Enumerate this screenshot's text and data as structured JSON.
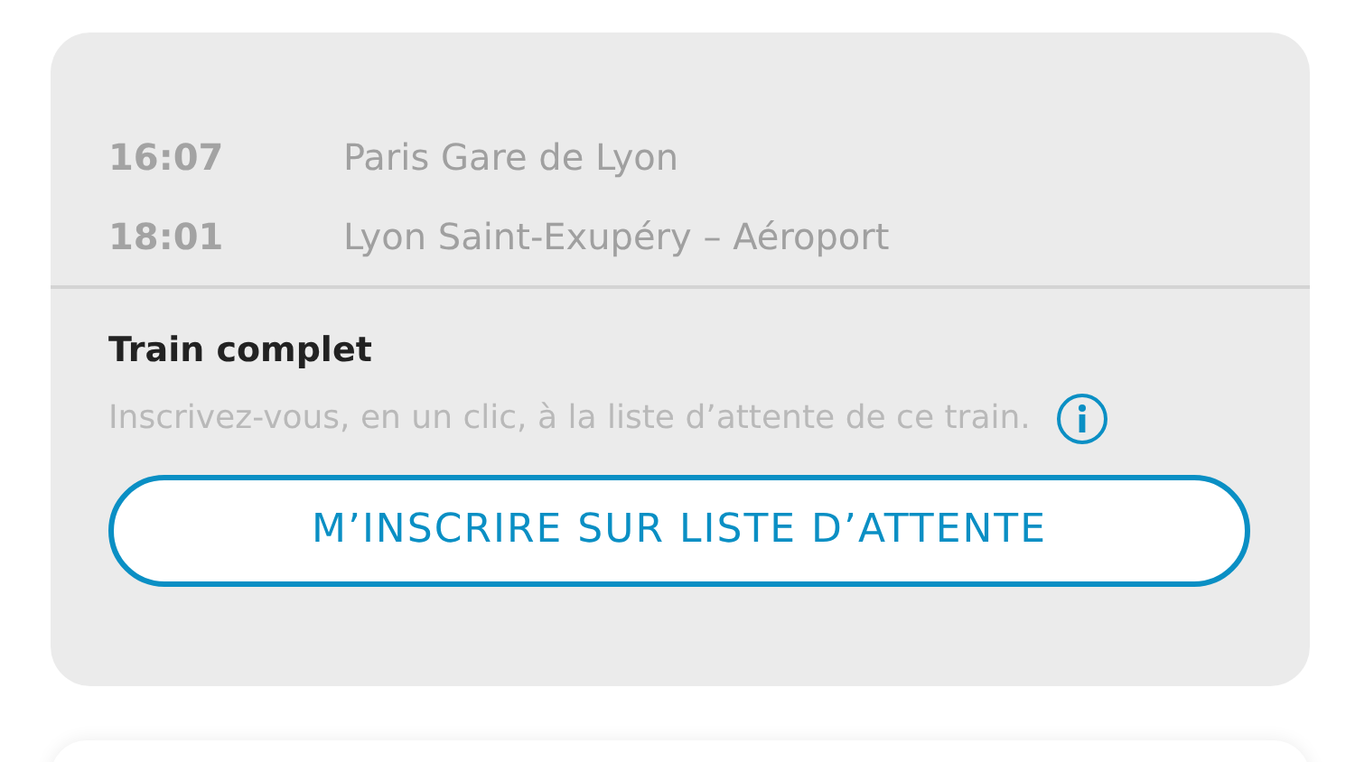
{
  "schedule": [
    {
      "time": "16:07",
      "station": "Paris Gare de Lyon"
    },
    {
      "time": "18:01",
      "station": "Lyon Saint-Exupéry – Aéroport"
    }
  ],
  "status": {
    "title": "Train complet",
    "message": "Inscrivez-vous, en un clic, à la liste d’attente de ce train.",
    "button": "M’INSCRIRE SUR LISTE D’ATTENTE"
  }
}
